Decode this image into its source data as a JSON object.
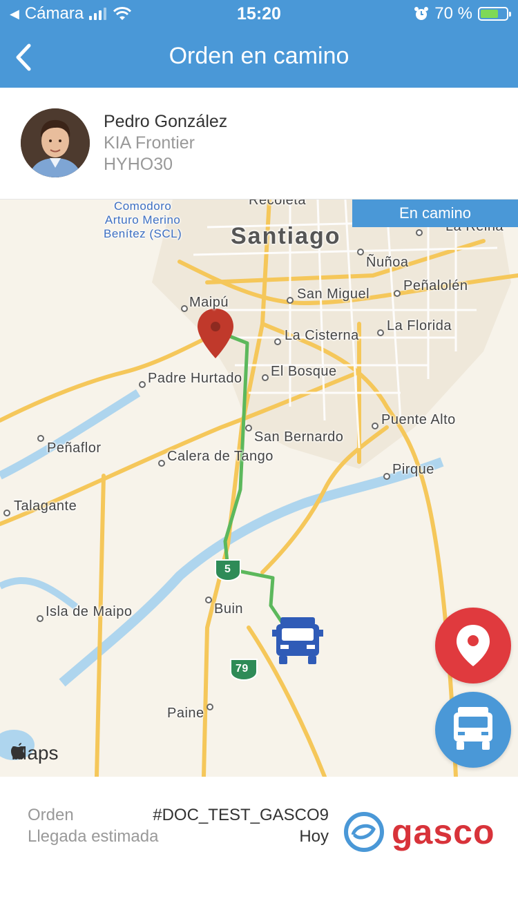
{
  "status_bar": {
    "carrier": "Cámara",
    "time": "15:20",
    "battery": "70 %"
  },
  "header": {
    "title": "Orden en camino"
  },
  "driver": {
    "name": "Pedro González",
    "vehicle": "KIA Frontier",
    "plate": "HYHO30"
  },
  "map": {
    "status_chip": "En camino",
    "labels": {
      "airport": "Comodoro\nArturo Merino\nBenítez (SCL)",
      "recoleta": "Recoleta",
      "santiago": "Santiago",
      "la_reina": "La Reina",
      "nunoa": "Ñuñoa",
      "penalolen": "Peñalolén",
      "maipu": "Maipú",
      "san_miguel": "San Miguel",
      "la_cisterna": "La Cisterna",
      "la_florida": "La Florida",
      "padre_hurtado": "Padre Hurtado",
      "el_bosque": "El Bosque",
      "puente_alto": "Puente Alto",
      "penaflor": "Peñaflor",
      "san_bernardo": "San Bernardo",
      "calera_de_tango": "Calera de Tango",
      "pirque": "Pirque",
      "talagante": "Talagante",
      "isla_de_maipo": "Isla de Maipo",
      "buin": "Buin",
      "paine": "Paine",
      "route_5": "5",
      "route_79": "79"
    },
    "attribution": "Maps",
    "colors": {
      "route": "#5cb85c",
      "destination_pin": "#c0392b",
      "truck": "#2f5bb7"
    }
  },
  "buttons": {
    "destination_icon": "location-pin-icon",
    "truck_icon": "truck-icon"
  },
  "order": {
    "order_label": "Orden",
    "order_value": "#DOC_TEST_GASCO9",
    "eta_label": "Llegada estimada",
    "eta_value": "Hoy"
  },
  "brand": {
    "name": "gasco",
    "color": "#d8333a",
    "accent": "#4a98d7"
  }
}
